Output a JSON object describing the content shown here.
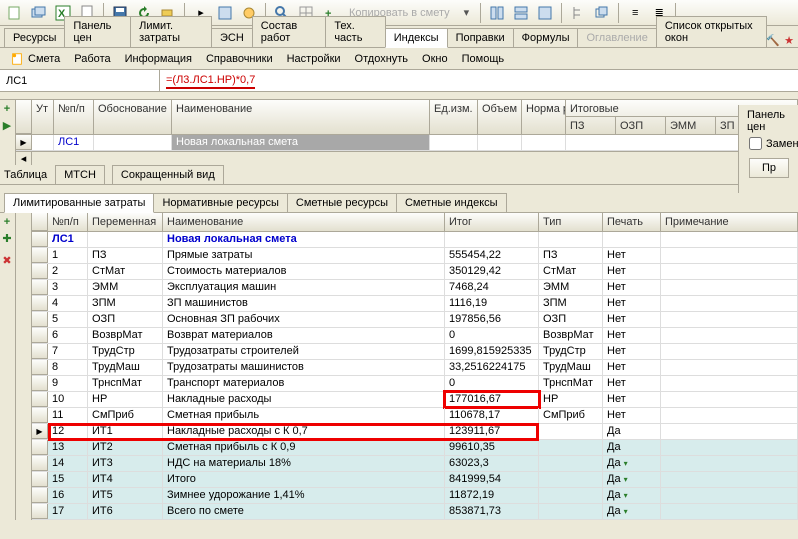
{
  "toolbar1": {
    "copy_label": "Копировать в смету"
  },
  "tabs1": [
    "Ресурсы",
    "Панель цен",
    "Лимит. затраты",
    "ЭСН",
    "Состав работ",
    "Тех. часть",
    "Индексы",
    "Поправки",
    "Формулы",
    "Оглавление",
    "Список открытых окон"
  ],
  "tabs1_active": 6,
  "menubar": [
    {
      "icon": "doc",
      "label": "Смета"
    },
    {
      "icon": "",
      "label": "Работа"
    },
    {
      "icon": "",
      "label": "Информация"
    },
    {
      "icon": "",
      "label": "Справочники"
    },
    {
      "icon": "",
      "label": "Настройки"
    },
    {
      "icon": "",
      "label": "Отдохнуть"
    },
    {
      "icon": "",
      "label": "Окно"
    },
    {
      "icon": "",
      "label": "Помощь"
    }
  ],
  "formula": {
    "cell": "ЛС1",
    "expr": "=(Л3.ЛС1.НР)*0,7"
  },
  "upper_grid": {
    "headers_l1": [
      "Ут",
      "№п/п",
      "Обоснование",
      "Наименование",
      "Ед.изм.",
      "Объем",
      "Норма расход."
    ],
    "headers_l2_group": "Итоговые",
    "headers_l2": [
      "ПЗ",
      "ОЗП",
      "ЭММ",
      "ЗП"
    ],
    "row": {
      "id": "ЛС1",
      "name": "Новая локальная смета"
    }
  },
  "mtcn_tabs": {
    "left": "Таблица",
    "items": [
      "МТСН",
      "Сокращенный вид"
    ]
  },
  "lower_tabs": [
    "Лимитированные затраты",
    "Нормативные ресурсы",
    "Сметные ресурсы",
    "Сметные индексы"
  ],
  "lower_tabs_active": 0,
  "lower_grid": {
    "headers": [
      "№п/п",
      "Переменная",
      "Наименование",
      "Итог",
      "Тип",
      "Печать",
      "Примечание"
    ],
    "section_row": {
      "id": "ЛС1",
      "name": "Новая локальная смета"
    },
    "rows": [
      {
        "n": "1",
        "var": "ПЗ",
        "name": "Прямые затраты",
        "itog": "555454,22",
        "tip": "ПЗ",
        "print": "Нет"
      },
      {
        "n": "2",
        "var": "СтМат",
        "name": "Стоимость материалов",
        "itog": "350129,42",
        "tip": "СтМат",
        "print": "Нет"
      },
      {
        "n": "3",
        "var": "ЭММ",
        "name": "Эксплуатация машин",
        "itog": "7468,24",
        "tip": "ЭММ",
        "print": "Нет"
      },
      {
        "n": "4",
        "var": "ЗПМ",
        "name": "ЗП машинистов",
        "itog": "1116,19",
        "tip": "ЗПМ",
        "print": "Нет"
      },
      {
        "n": "5",
        "var": "ОЗП",
        "name": "Основная ЗП рабочих",
        "itog": "197856,56",
        "tip": "ОЗП",
        "print": "Нет"
      },
      {
        "n": "6",
        "var": "ВозврМат",
        "name": "Возврат материалов",
        "itog": "0",
        "tip": "ВозврМат",
        "print": "Нет"
      },
      {
        "n": "7",
        "var": "ТрудСтр",
        "name": "Трудозатраты строителей",
        "itog": "1699,815925335",
        "tip": "ТрудСтр",
        "print": "Нет"
      },
      {
        "n": "8",
        "var": "ТрудМаш",
        "name": "Трудозатраты машинистов",
        "itog": "33,2516224175",
        "tip": "ТрудМаш",
        "print": "Нет"
      },
      {
        "n": "9",
        "var": "ТрнспМат",
        "name": "Транспорт материалов",
        "itog": "0",
        "tip": "ТрнспМат",
        "print": "Нет"
      },
      {
        "n": "10",
        "var": "НР",
        "name": "Накладные расходы",
        "itog": "177016,67",
        "tip": "НР",
        "print": "Нет",
        "hl_itog": true
      },
      {
        "n": "11",
        "var": "СмПриб",
        "name": "Сметная прибыль",
        "itog": "110678,17",
        "tip": "СмПриб",
        "print": "Нет"
      },
      {
        "n": "12",
        "var": "ИТ1",
        "name": "Накладные расходы с К 0,7",
        "itog": "123911,67",
        "tip": "",
        "print": "Да",
        "hl_row": true,
        "active": true
      },
      {
        "n": "13",
        "var": "ИТ2",
        "name": "Сметная прибыль с К 0,9",
        "itog": "99610,35",
        "tip": "",
        "print": "Да",
        "alt": true
      },
      {
        "n": "14",
        "var": "ИТ3",
        "name": "НДС на материалы  18%",
        "itog": "63023,3",
        "tip": "",
        "print": "Да",
        "alt": true,
        "mark": true
      },
      {
        "n": "15",
        "var": "ИТ4",
        "name": "Итого",
        "itog": "841999,54",
        "tip": "",
        "print": "Да",
        "alt": true,
        "mark": true
      },
      {
        "n": "16",
        "var": "ИТ5",
        "name": "Зимнее удорожание 1,41%",
        "itog": "11872,19",
        "tip": "",
        "print": "Да",
        "alt": true,
        "mark": true
      },
      {
        "n": "17",
        "var": "ИТ6",
        "name": "Всего по смете",
        "itog": "853871,73",
        "tip": "",
        "print": "Да",
        "alt": true,
        "mark": true
      }
    ]
  },
  "side": {
    "title": "Панель цен",
    "checkbox": "Замен",
    "btn": "Пр"
  }
}
